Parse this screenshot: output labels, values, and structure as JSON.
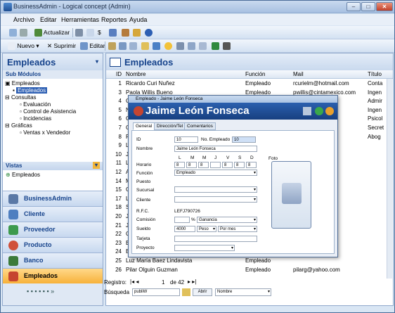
{
  "window": {
    "title": "BusinessAdmin - Logical concept (Admin)"
  },
  "menu": [
    "Archivo",
    "Editar",
    "Herramientas",
    "Reportes",
    "Ayuda"
  ],
  "toolbar1": {
    "actualizar": "Actualizar"
  },
  "toolbar2": {
    "nuevo": "Nuevo",
    "suprimir": "Suprimir",
    "editar": "Editar"
  },
  "left": {
    "header": "Empleados",
    "sub": "Sub Módulos",
    "tree": [
      {
        "label": "Empleados",
        "lvl": 0
      },
      {
        "label": "Empleados",
        "lvl": 1,
        "sel": true
      },
      {
        "label": "Consultas",
        "lvl": 0
      },
      {
        "label": "Evaluación",
        "lvl": 2
      },
      {
        "label": "Control de Asistencia",
        "lvl": 2
      },
      {
        "label": "Incidencias",
        "lvl": 2
      },
      {
        "label": "Gráficas",
        "lvl": 0
      },
      {
        "label": "Ventas x Vendedor",
        "lvl": 2
      }
    ],
    "vistas": "Vistas",
    "vista_item": "Empleados",
    "nav": [
      "BusinessAdmin",
      "Cliente",
      "Proveedor",
      "Producto",
      "Banco",
      "Empleados"
    ]
  },
  "main": {
    "header": "Empleados",
    "columns": [
      "ID",
      "Nombre",
      "Función",
      "Mail",
      "Título"
    ],
    "rows": [
      [
        "1",
        "Ricardo Curi Nuñez",
        "Empleado",
        "rcurielm@hotmail.com",
        "Conta"
      ],
      [
        "3",
        "Paola Willis Bueno",
        "Empleado",
        "pwillis@cintamexico.com",
        "Ingen"
      ],
      [
        "4",
        "G",
        "",
        "ail.com",
        "Admir"
      ],
      [
        "5",
        "N",
        "",
        "mail.com",
        "Ingen"
      ],
      [
        "6",
        "G",
        "",
        "ail.com",
        "Psicol"
      ],
      [
        "7",
        "C",
        "",
        "@yahoo.",
        "Secret"
      ],
      [
        "8",
        "R",
        "",
        "m",
        "Abog"
      ],
      [
        "9",
        "L",
        "",
        "m",
        ""
      ],
      [
        "10",
        "J",
        "",
        "",
        ""
      ],
      [
        "11",
        "L",
        "",
        "m",
        ""
      ],
      [
        "12",
        "A",
        "",
        "om.mx",
        ""
      ],
      [
        "14",
        "M",
        "",
        "gmail.com",
        ""
      ],
      [
        "15",
        "G",
        "",
        "m",
        ""
      ],
      [
        "17",
        "L",
        "",
        "com",
        ""
      ],
      [
        "18",
        "S",
        "",
        "com",
        ""
      ],
      [
        "20",
        "J",
        "",
        "ail.com",
        ""
      ],
      [
        "21",
        "J",
        "",
        "m",
        ""
      ],
      [
        "22",
        "C",
        "",
        "com",
        ""
      ],
      [
        "23",
        "E",
        "",
        "mail.com",
        ""
      ],
      [
        "24",
        "E",
        "",
        "m",
        ""
      ],
      [
        "25",
        "Luz María Baez Lindavista",
        "Empleado",
        "",
        ""
      ],
      [
        "26",
        "Pilar Olguin Guzman",
        "Empleado",
        "pilarg@yahoo.com",
        ""
      ]
    ],
    "status": {
      "label": "Registro:",
      "current": "1",
      "of": "de 42"
    },
    "search": {
      "label": "Búsqueda",
      "value": "publiW",
      "button": "Abrir",
      "field": "Nombre"
    }
  },
  "dialog": {
    "title": "Empleado - Jaime León Fonseca",
    "name": "Jaime León Fonseca",
    "tabs": [
      "General",
      "Dirección/Tel",
      "Comentarios"
    ],
    "labels": {
      "id": "ID",
      "no_emp": "No. Empleado",
      "nombre": "Nombre",
      "horario": "Horario",
      "funcion": "Función",
      "puesto": "Puesto",
      "sucursal": "Sucursal",
      "cliente": "Cliente",
      "rfc": "R.F.C.",
      "comision": "Comisión",
      "sueldo": "Sueldo",
      "tarjeta": "Tarjeta",
      "proyecto": "Proyecto",
      "foto": "Foto"
    },
    "values": {
      "id": "10",
      "no_emp": "10",
      "nombre": "Jaime León Fonseca",
      "funcion": "Empleado",
      "rfc": "LEFJ790726",
      "comision_unit": "%",
      "comision": "Ganancia",
      "sueldo": "4000",
      "sueldo_p": "Peso",
      "sueldo_m": "Por mes"
    },
    "days": [
      "L",
      "M",
      "M",
      "J",
      "V",
      "S",
      "D"
    ],
    "hours": [
      "8",
      "8",
      "8",
      "",
      "8",
      "8",
      "8"
    ]
  }
}
